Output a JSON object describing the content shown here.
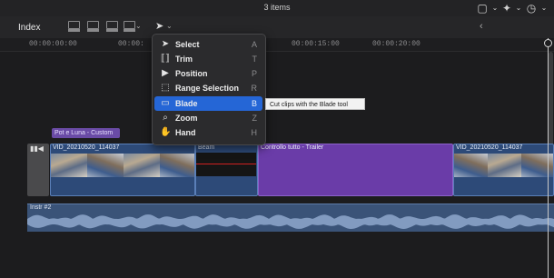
{
  "header": {
    "items_count": "3 items"
  },
  "toolbar": {
    "index_label": "Index"
  },
  "ruler": {
    "ticks": [
      "00:00:00:00",
      "00:00:",
      "00:00:15:00",
      "00:00:20:00"
    ]
  },
  "menu": {
    "items": [
      {
        "label": "Select",
        "key": "A",
        "icon": "arrow-pointer-icon"
      },
      {
        "label": "Trim",
        "key": "T",
        "icon": "trim-icon"
      },
      {
        "label": "Position",
        "key": "P",
        "icon": "position-icon"
      },
      {
        "label": "Range Selection",
        "key": "R",
        "icon": "range-selection-icon"
      },
      {
        "label": "Blade",
        "key": "B",
        "icon": "blade-icon"
      },
      {
        "label": "Zoom",
        "key": "Z",
        "icon": "zoom-icon"
      },
      {
        "label": "Hand",
        "key": "H",
        "icon": "hand-icon"
      }
    ],
    "selected": "Blade"
  },
  "tooltip": "Cut clips with the Blade tool",
  "timeline": {
    "title_clip": "Pot e Luna - Custom",
    "clips": [
      {
        "label": "VID_20210520_114037"
      },
      {
        "label": "Beam"
      },
      {
        "label": "Controllo tutto - Trailer"
      },
      {
        "label": "VID_20210520_114037"
      }
    ],
    "audio_label": "Instr #2"
  },
  "colors": {
    "accent": "#2566d6",
    "clip_blue": "#2d4a78",
    "clip_purple": "#6a3ca8"
  }
}
